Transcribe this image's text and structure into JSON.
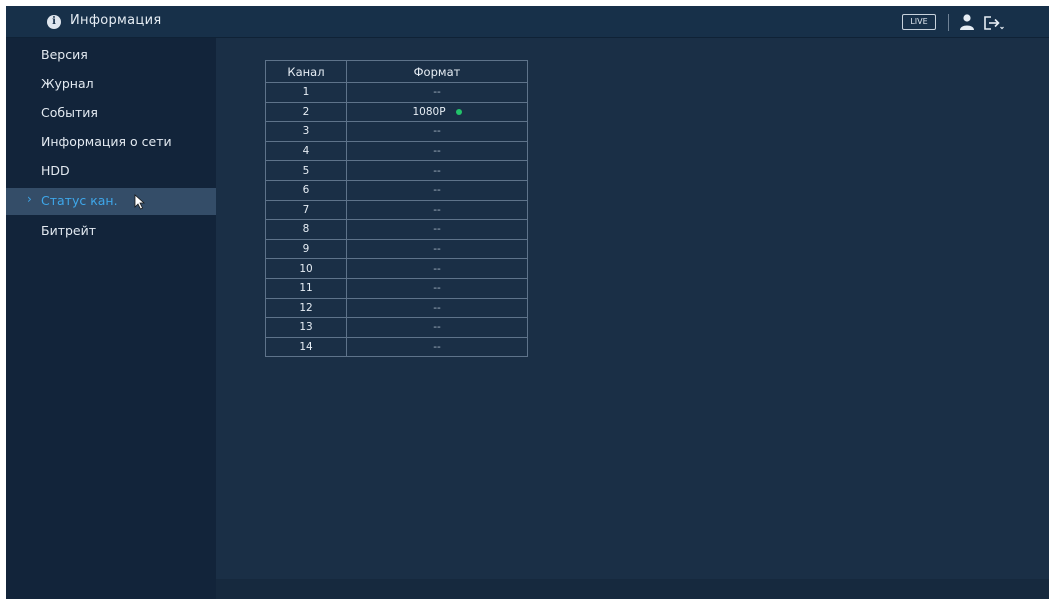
{
  "header": {
    "title": "Информация",
    "live_label": "LIVE"
  },
  "sidebar": {
    "items": [
      {
        "label": "Версия"
      },
      {
        "label": "Журнал"
      },
      {
        "label": "События"
      },
      {
        "label": "Информация о сети"
      },
      {
        "label": "HDD"
      },
      {
        "label": "Статус кан.",
        "active": true
      },
      {
        "label": "Битрейт"
      }
    ]
  },
  "table": {
    "headers": [
      "Канал",
      "Формат"
    ],
    "rows": [
      {
        "channel": "1",
        "format": "--"
      },
      {
        "channel": "2",
        "format": "1080P",
        "status_color": "#22c36a"
      },
      {
        "channel": "3",
        "format": "--"
      },
      {
        "channel": "4",
        "format": "--"
      },
      {
        "channel": "5",
        "format": "--"
      },
      {
        "channel": "6",
        "format": "--"
      },
      {
        "channel": "7",
        "format": "--"
      },
      {
        "channel": "8",
        "format": "--"
      },
      {
        "channel": "9",
        "format": "--"
      },
      {
        "channel": "10",
        "format": "--"
      },
      {
        "channel": "11",
        "format": "--"
      },
      {
        "channel": "12",
        "format": "--"
      },
      {
        "channel": "13",
        "format": "--"
      },
      {
        "channel": "14",
        "format": "--"
      }
    ]
  },
  "colors": {
    "background": "#1a2f46",
    "sidebar": "#12243a",
    "active_item_bg": "#344d68",
    "active_text": "#3ea7ea",
    "status_ok": "#22c36a"
  }
}
